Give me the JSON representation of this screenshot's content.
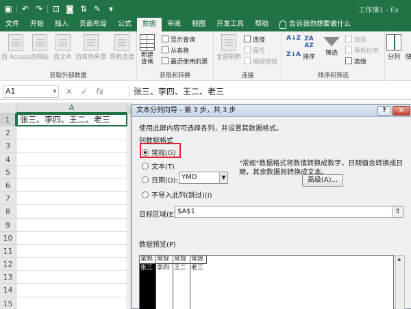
{
  "window": {
    "title": "工作簿1 - Ex"
  },
  "tabs": [
    "文件",
    "开始",
    "插入",
    "页面布局",
    "公式",
    "数据",
    "审阅",
    "视图",
    "开发工具",
    "帮助"
  ],
  "active_tab": "数据",
  "tell_me": "告诉我你想要做什么",
  "ribbon": {
    "get_external": {
      "label": "获取外部数据",
      "buttons": [
        "自 Access",
        "自网站",
        "自文本",
        "自其他来源",
        "现有连接"
      ]
    },
    "get_transform": {
      "label": "获取和转换",
      "new_query": "新建\n查询",
      "small": [
        "显示查询",
        "从表格",
        "最近使用的源"
      ]
    },
    "connections": {
      "label": "连接",
      "refresh_all": "全部刷新",
      "small": [
        "连接",
        "属性",
        "编辑链接"
      ]
    },
    "sort_filter": {
      "label": "排序和筛选",
      "sort": "排序",
      "filter": "筛选",
      "small": [
        "清除",
        "重新应用",
        "高级"
      ],
      "az_top": "A↓Z",
      "za_top": "Z↓A",
      "az_grid": "ZA\nAZ"
    },
    "tools": {
      "split": "分列",
      "more": "快"
    }
  },
  "formula_bar": {
    "name_box": "A1",
    "cancel": "✕",
    "enter": "✓",
    "fx": "fx",
    "value": "张三、李四、王二、老三"
  },
  "sheet": {
    "column": "A",
    "rows": [
      {
        "num": "1",
        "value": "张三、李四、王二、老三"
      },
      {
        "num": "2",
        "value": ""
      },
      {
        "num": "3",
        "value": ""
      },
      {
        "num": "4",
        "value": ""
      },
      {
        "num": "5",
        "value": ""
      },
      {
        "num": "6",
        "value": ""
      },
      {
        "num": "7",
        "value": ""
      },
      {
        "num": "8",
        "value": ""
      },
      {
        "num": "9",
        "value": ""
      },
      {
        "num": "10",
        "value": ""
      },
      {
        "num": "11",
        "value": ""
      },
      {
        "num": "12",
        "value": ""
      },
      {
        "num": "13",
        "value": ""
      },
      {
        "num": "14",
        "value": ""
      },
      {
        "num": "15",
        "value": ""
      }
    ]
  },
  "dialog": {
    "title": "文本分列向导 - 第 3 步，共 3 步",
    "help": "?",
    "close": "✕",
    "instruction": "使用此屏内容可选择各列，并设置其数据格式。",
    "format_group": "列数据格式",
    "options": [
      "常规(G)",
      "文本(T)",
      "日期(D):",
      "不导入此列(跳过)(I)"
    ],
    "selected_option": "常规(G)",
    "date_format": "YMD",
    "description": "\"常规\"数据格式将数值转换成数字，日期值会转换成日期，其余数据则转换成文本。",
    "advanced": "高级(A)...",
    "target_label": "目标区域(E):",
    "target_value": "$A$1",
    "preview_label": "数据预览(P)",
    "preview": {
      "headers": [
        "常规",
        "常规",
        "常规",
        "常规"
      ],
      "row": [
        "张三",
        "李四",
        "王二",
        "老三"
      ]
    }
  }
}
